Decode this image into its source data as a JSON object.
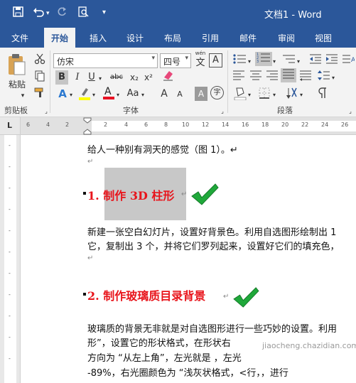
{
  "titlebar": {
    "save_icon": "save-icon",
    "undo_icon": "undo-icon",
    "redo_icon": "redo-icon",
    "preview_icon": "print-preview-icon",
    "customize_icon": "customize-quick-access-icon",
    "title": "文档1 - Word",
    "accent": "#2b579a"
  },
  "menu": {
    "file": "文件",
    "home": "开始",
    "insert": "插入",
    "design": "设计",
    "layout": "布局",
    "references": "引用",
    "mailings": "邮件",
    "review": "审阅",
    "view": "视图"
  },
  "ribbon": {
    "paste_label": "粘贴",
    "clipboard_label": "剪贴板",
    "font_label": "字体",
    "paragraph_label": "段落",
    "font_name": "仿宋",
    "font_size": "四号",
    "wen_label": "wén",
    "wen_char": "文",
    "A_char": "A",
    "bold": "B",
    "italic": "I",
    "underline": "U",
    "strike": "abc",
    "subscript": "x₂",
    "superscript": "x²",
    "aa": "Aa",
    "grow": "A",
    "shrink": "A",
    "zi": "字",
    "font_color_accent": "#e81123",
    "highlight_accent": "#ffff00"
  },
  "ruler": {
    "h_ticks": [
      "6",
      "4",
      "2",
      "2",
      "4",
      "6",
      "8",
      "10",
      "12",
      "14",
      "16",
      "18",
      "20",
      "22",
      "24",
      "26"
    ],
    "tab_icon": "L"
  },
  "document": {
    "line1": "给人一种别有洞天的感觉（图 1）。↵",
    "empty_mark": "↵",
    "heading1": "1. 制作 3D 柱形",
    "heading1_mark": "↵",
    "para1_line1": "新建一张空白幻灯片，设置好背景色。利用自选图形绘制出 1",
    "para1_line2": "它，复制出 3 个，并将它们罗列起来，设置好它们的填充色，",
    "heading2": "2. 制作玻璃质目录背景",
    "heading2_mark": "↵",
    "para2_line1": "玻璃质的背景无非就是对自选图形进行一些巧妙的设置。利用",
    "para2_line2": "形”，设置它的形状格式，在形状右",
    "para2_line3": "方向为 “从左上角”，左光就是    ，左光",
    "para2_line4": "-89%，右光圈颜色为 “浅灰状格式，<行，，进行",
    "heading_color": "#e8141b",
    "check_color": "#1fa83a"
  },
  "watermark": "jiaocheng.chazidian.com"
}
